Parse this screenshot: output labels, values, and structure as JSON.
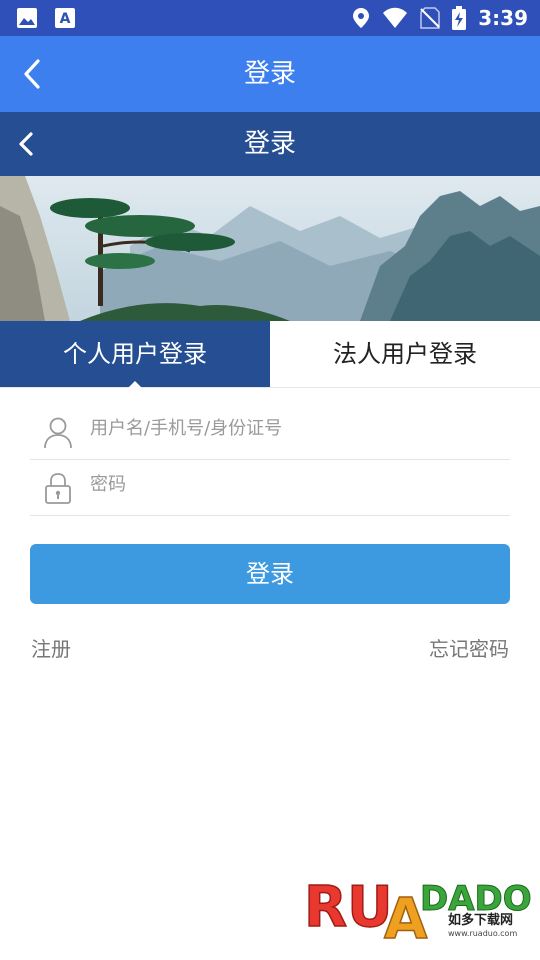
{
  "status_bar": {
    "time": "3:39",
    "left_icons": [
      "image-icon",
      "font-icon"
    ],
    "right_icons": [
      "location-icon",
      "wifi-icon",
      "no-sim-icon",
      "battery-charging-icon"
    ]
  },
  "outer_appbar": {
    "title": "登录",
    "back_icon": "chevron-left-icon"
  },
  "inner_appbar": {
    "title": "登录",
    "back_icon": "chevron-left-icon"
  },
  "tabs": {
    "personal_label": "个人用户登录",
    "legal_label": "法人用户登录",
    "active": "personal"
  },
  "form": {
    "username_placeholder": "用户名/手机号/身份证号",
    "password_placeholder": "密码",
    "login_button": "登录"
  },
  "links": {
    "register": "注册",
    "forgot_password": "忘记密码"
  },
  "watermark": {
    "brand_text": "RUANDADUO",
    "cn_text": "如多下载网",
    "url": "www.ruaduo.com"
  },
  "colors": {
    "status_bar": "#2f50b8",
    "outer_appbar": "#3e7ff0",
    "inner_appbar": "#254f92",
    "active_tab": "#254f92",
    "login_button": "#3d9ae0"
  }
}
